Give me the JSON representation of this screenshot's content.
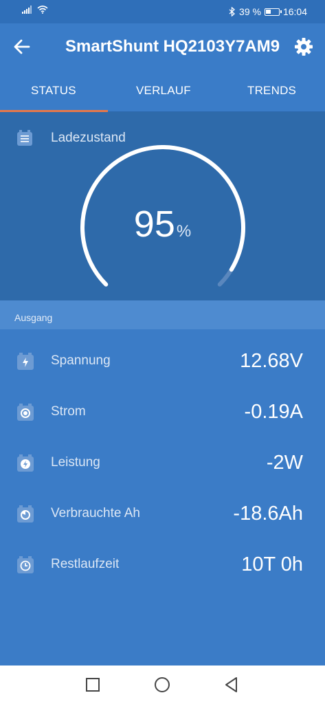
{
  "status_bar": {
    "battery_percent_text": "39 %",
    "battery_level": 0.39,
    "time": "16:04"
  },
  "app_bar": {
    "title": "SmartShunt HQ2103Y7AM9"
  },
  "tabs": [
    {
      "label": "STATUS",
      "active": true
    },
    {
      "label": "VERLAUF",
      "active": false
    },
    {
      "label": "TRENDS",
      "active": false
    }
  ],
  "state_of_charge": {
    "label": "Ladezustand",
    "value": "95",
    "unit": "%",
    "level": 0.95
  },
  "section": {
    "title": "Ausgang"
  },
  "readings": [
    {
      "label": "Spannung",
      "value": "12.68V",
      "icon": "voltage-icon"
    },
    {
      "label": "Strom",
      "value": "-0.19A",
      "icon": "current-icon"
    },
    {
      "label": "Leistung",
      "value": "-2W",
      "icon": "power-icon"
    },
    {
      "label": "Verbrauchte Ah",
      "value": "-18.6Ah",
      "icon": "consumed-ah-icon"
    },
    {
      "label": "Restlaufzeit",
      "value": "10T 0h",
      "icon": "clock-icon"
    }
  ],
  "colors": {
    "accent_tab": "#e6784a",
    "background": "#3b7cc7",
    "header": "#3a7cc8"
  }
}
